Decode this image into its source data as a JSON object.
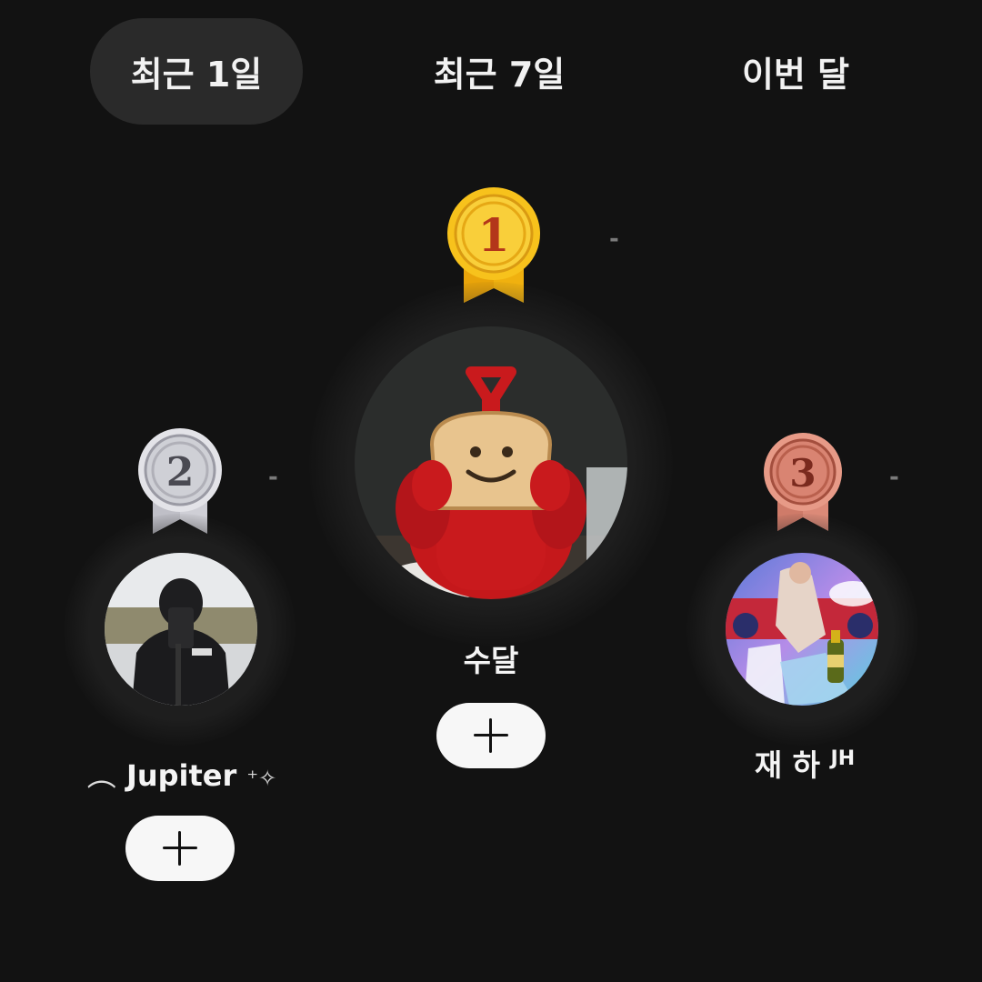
{
  "tabs": [
    {
      "label": "최근 1일",
      "active": true
    },
    {
      "label": "최근 7일",
      "active": false
    },
    {
      "label": "이번 달",
      "active": false
    }
  ],
  "podium": {
    "first": {
      "rank": "1",
      "medal": "gold-medal-icon",
      "rank_change": "-",
      "nickname": "수달",
      "avatar": "bread-mask-red-character",
      "follow_icon": "plus-icon"
    },
    "second": {
      "rank": "2",
      "medal": "silver-medal-icon",
      "rank_change": "-",
      "nickname_prefix": "︵",
      "nickname": "Jupiter",
      "nickname_suffix": "⁺✧",
      "avatar": "person-camera-mirror-selfie",
      "follow_icon": "plus-icon"
    },
    "third": {
      "rank": "3",
      "medal": "bronze-medal-icon",
      "rank_change": "-",
      "nickname": "재 하",
      "nickname_suffix": "JH",
      "avatar": "colorful-party-champagne",
      "follow_icon": "plus-icon"
    }
  },
  "colors": {
    "background": "#121212",
    "active_tab": "#2a2a2a",
    "gold": "#f2b51c",
    "silver": "#d8d8dc",
    "bronze": "#d98a78",
    "button": "#f7f7f7"
  }
}
